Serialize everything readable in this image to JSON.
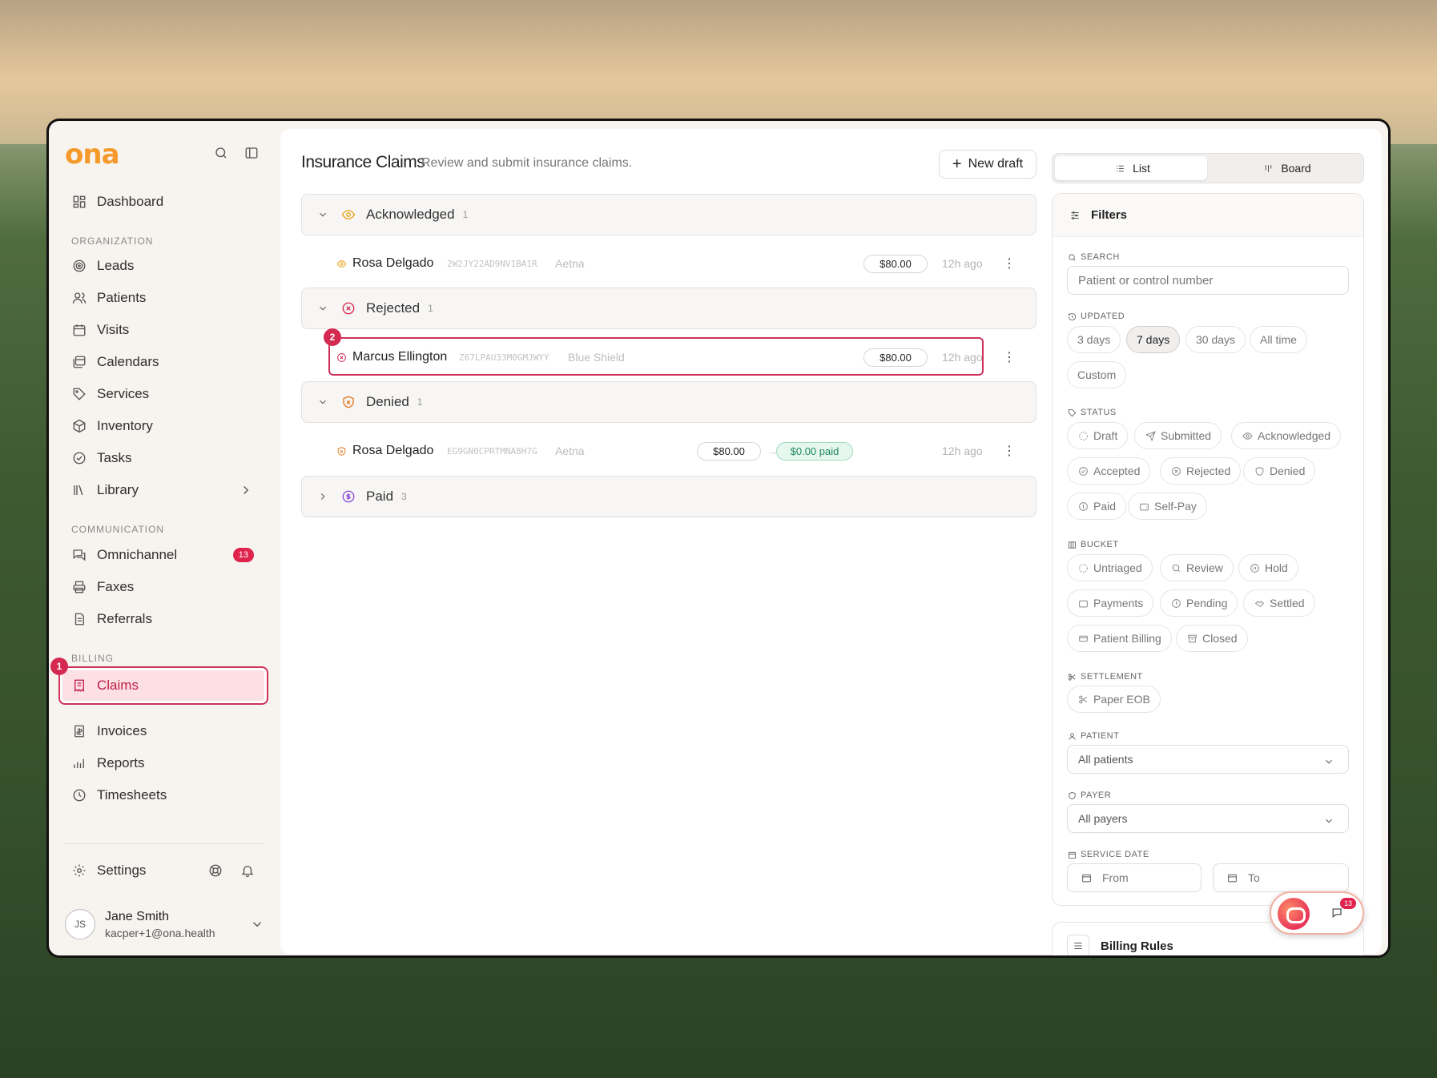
{
  "app": {
    "logo": "ona"
  },
  "sidebar": {
    "dashboard": "Dashboard",
    "sections": {
      "organization": "ORGANIZATION",
      "communication": "COMMUNICATION",
      "billing": "BILLING"
    },
    "org_items": [
      "Leads",
      "Patients",
      "Visits",
      "Calendars",
      "Services",
      "Inventory",
      "Tasks",
      "Library"
    ],
    "comm_items": [
      "Omnichannel",
      "Faxes",
      "Referrals"
    ],
    "omnichannel_badge": "13",
    "billing_items": [
      "Claims",
      "Invoices",
      "Reports",
      "Timesheets"
    ],
    "settings": "Settings",
    "user": {
      "initials": "JS",
      "name": "Jane Smith",
      "email": "kacper+1@ona.health"
    }
  },
  "steps": {
    "one": "1",
    "two": "2"
  },
  "header": {
    "title": "Insurance Claims",
    "subtitle": "Review and submit insurance claims.",
    "new_draft": "New draft"
  },
  "view_toggle": {
    "list": "List",
    "board": "Board",
    "active": "List"
  },
  "groups": [
    {
      "label": "Acknowledged",
      "count": "1",
      "expanded": true
    },
    {
      "label": "Rejected",
      "count": "1",
      "expanded": true
    },
    {
      "label": "Denied",
      "count": "1",
      "expanded": true
    },
    {
      "label": "Paid",
      "count": "3",
      "expanded": false
    }
  ],
  "claims": [
    {
      "patient": "Rosa Delgado",
      "control": "2W2JY22AD9NV1BA1R",
      "payer": "Aetna",
      "amount": "$80.00",
      "paid": "",
      "time": "12h ago"
    },
    {
      "patient": "Marcus Ellington",
      "control": "Z67LPAU33M0GMJWYY",
      "payer": "Blue Shield",
      "amount": "$80.00",
      "paid": "",
      "time": "12h ago"
    },
    {
      "patient": "Rosa Delgado",
      "control": "EG9GN0CPRTMNA8H7G",
      "payer": "Aetna",
      "amount": "$80.00",
      "paid": "$0.00 paid",
      "time": "12h ago"
    }
  ],
  "filters": {
    "title": "Filters",
    "search": {
      "label": "SEARCH",
      "placeholder": "Patient or control number"
    },
    "updated": {
      "label": "UPDATED",
      "options": [
        "3 days",
        "7 days",
        "30 days",
        "All time",
        "Custom"
      ],
      "selected": "7 days"
    },
    "status": {
      "label": "STATUS",
      "options": [
        "Draft",
        "Submitted",
        "Acknowledged",
        "Accepted",
        "Rejected",
        "Denied",
        "Paid",
        "Self-Pay"
      ]
    },
    "bucket": {
      "label": "BUCKET",
      "options": [
        "Untriaged",
        "Review",
        "Hold",
        "Payments",
        "Pending",
        "Settled",
        "Patient Billing",
        "Closed"
      ]
    },
    "settlement": {
      "label": "SETTLEMENT",
      "options": [
        "Paper EOB"
      ]
    },
    "patient": {
      "label": "PATIENT",
      "value": "All patients"
    },
    "payer": {
      "label": "PAYER",
      "value": "All payers"
    },
    "service_date": {
      "label": "SERVICE DATE",
      "from": "From",
      "to": "To"
    }
  },
  "billing_rules": "Billing Rules",
  "chat": {
    "badge": "13"
  },
  "colors": {
    "accent": "#cf3159",
    "acknowledged": "#e8a317",
    "rejected": "#d42a52",
    "denied": "#e07a1f",
    "paid": "#8a4fd6"
  }
}
